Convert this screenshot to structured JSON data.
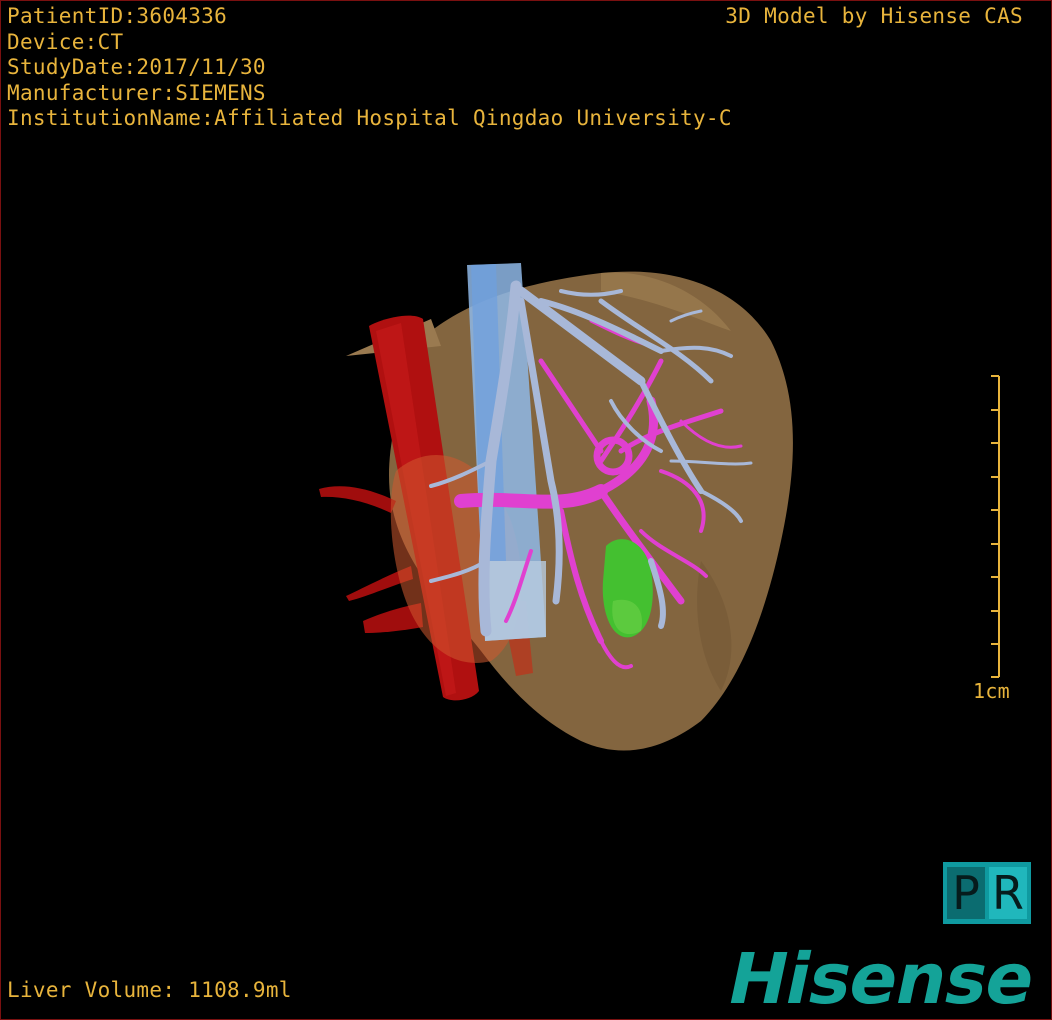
{
  "header": {
    "patient_id": "PatientID:3604336",
    "device": "Device:CT",
    "study_date": "StudyDate:2017/11/30",
    "manufacturer": "Manufacturer:SIEMENS",
    "institution": "InstitutionName:Affiliated Hospital Qingdao University-C"
  },
  "brand_text": "3D Model by Hisense CAS",
  "scale": {
    "label": "1cm",
    "tick_count": 10
  },
  "footer": {
    "liver_volume": "Liver Volume: 1108.9ml"
  },
  "logo": {
    "pr_letters": [
      "P",
      "R"
    ],
    "company": "Hisense"
  },
  "colors": {
    "overlay_text": "#e8b43c",
    "liver": "#8a6a42",
    "aorta": "#b01010",
    "vena_cava": "#8fb8e8",
    "portal_vein": "#e040d0",
    "hepatic_vein": "#a8b8d8",
    "tumor": "#44c030",
    "logo": "#14a398"
  },
  "icons": {
    "pr_logo": "pr-badge-icon",
    "scale_bar": "scale-bar-icon"
  }
}
